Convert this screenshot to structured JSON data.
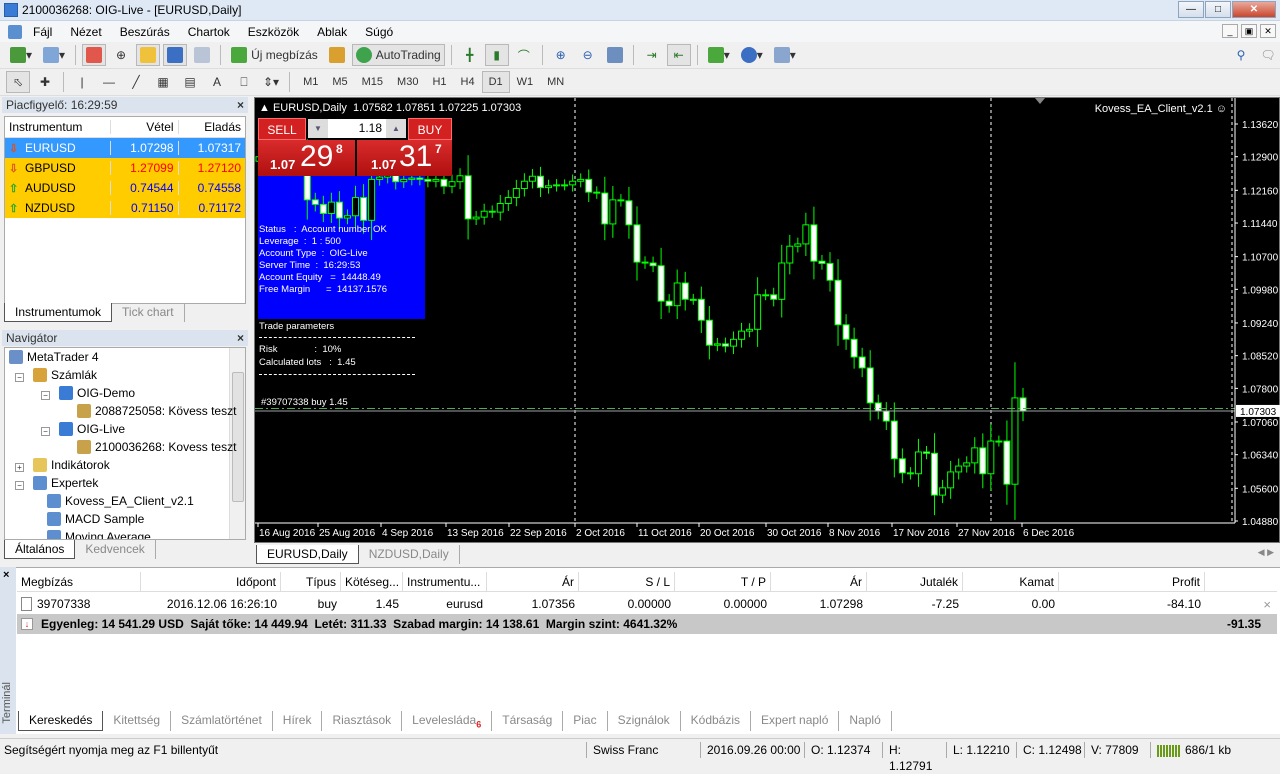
{
  "window": {
    "title": "2100036268: OIG-Live - [EURUSD,Daily]"
  },
  "menu": [
    "Fájl",
    "Nézet",
    "Beszúrás",
    "Chartok",
    "Eszközök",
    "Ablak",
    "Súgó"
  ],
  "toolbar": {
    "new_order": "Új megbízás",
    "autotrading": "AutoTrading",
    "timeframes": [
      "M1",
      "M5",
      "M15",
      "M30",
      "H1",
      "H4",
      "D1",
      "W1",
      "MN"
    ],
    "active_timeframe": "D1",
    "text_tool": "A"
  },
  "market_watch": {
    "title": "Piacfigyelő: 16:29:59",
    "columns": [
      "Instrumentum",
      "Vétel",
      "Eladás"
    ],
    "rows": [
      {
        "symbol": "EURUSD",
        "bid": "1.07298",
        "ask": "1.07317",
        "dir": "down",
        "selected": true,
        "color": "#ffffff"
      },
      {
        "symbol": "GBPUSD",
        "bid": "1.27099",
        "ask": "1.27120",
        "dir": "down",
        "selected": false,
        "color": "#ff0000"
      },
      {
        "symbol": "AUDUSD",
        "bid": "0.74544",
        "ask": "0.74558",
        "dir": "up",
        "selected": false,
        "color": "#0000ff"
      },
      {
        "symbol": "NZDUSD",
        "bid": "0.71150",
        "ask": "0.71172",
        "dir": "up",
        "selected": false,
        "color": "#0000ff"
      }
    ],
    "tabs": [
      "Instrumentumok",
      "Tick chart"
    ]
  },
  "navigator": {
    "title": "Navigátor",
    "items": [
      "MetaTrader 4",
      "Számlák",
      "OIG-Demo",
      "2088725058: Kövess teszt",
      "OIG-Live",
      "2100036268: Kovess teszt",
      "Indikátorok",
      "Expertek",
      "Kovess_EA_Client_v2.1",
      "MACD Sample",
      "Moving Average"
    ],
    "tabs": [
      "Általános",
      "Kedvencek"
    ]
  },
  "chart": {
    "header": "EURUSD,Daily  1.07582 1.07851 1.07225 1.07303",
    "ea_label": "Kovess_EA_Client_v2.1",
    "sell_label": "SELL",
    "buy_label": "BUY",
    "lots": "1.18",
    "sell_price": {
      "big": "1.07",
      "main": "29",
      "pip": "8"
    },
    "buy_price": {
      "big": "1.07",
      "main": "31",
      "pip": "7"
    },
    "info_lines": [
      "Status   :  Account number OK",
      "Leverage  :  1 : 500",
      "Account Type  :  OIG-Live",
      "Server Time  :  16:29:53",
      "Account Equity   =  14448.49",
      "Free Margin      =  14137.1576"
    ],
    "trade_params": [
      "Trade parameters",
      "Risk              :  10%",
      "Calculated lots   :  1.45"
    ],
    "order_label": "#39707338 buy 1.45",
    "current_price": "1.07303",
    "colors": {
      "background": "#000000",
      "candle": "#00ff00",
      "bear_body": "#ffffff",
      "info_panel": "#0000ff",
      "trade_button": "#d01818"
    },
    "tabs": [
      "EURUSD,Daily",
      "NZDUSD,Daily"
    ]
  },
  "chart_data": {
    "type": "candlestick",
    "symbol": "EURUSD",
    "timeframe": "Daily",
    "ylim": [
      1.0488,
      1.1362
    ],
    "y_ticks": [
      "1.13620",
      "1.12900",
      "1.12160",
      "1.11440",
      "1.10700",
      "1.09980",
      "1.09240",
      "1.08520",
      "1.07800",
      "1.07060",
      "1.06340",
      "1.05600",
      "1.04880"
    ],
    "x_ticks": [
      "16 Aug 2016",
      "25 Aug 2016",
      "4 Sep 2016",
      "13 Sep 2016",
      "22 Sep 2016",
      "2 Oct 2016",
      "11 Oct 2016",
      "20 Oct 2016",
      "30 Oct 2016",
      "8 Nov 2016",
      "17 Nov 2016",
      "27 Nov 2016",
      "6 Dec 2016"
    ],
    "first_open": 1.128,
    "closes": [
      1.129,
      1.133,
      1.1325,
      1.13,
      1.127,
      1.1285,
      1.1195,
      1.1185,
      1.1165,
      1.119,
      1.1155,
      1.116,
      1.12,
      1.115,
      1.124,
      1.1245,
      1.125,
      1.1235,
      1.124,
      1.1243,
      1.124,
      1.1236,
      1.124,
      1.1225,
      1.1235,
      1.1248,
      1.1153,
      1.1157,
      1.117,
      1.1168,
      1.1187,
      1.12,
      1.122,
      1.1236,
      1.1247,
      1.1222,
      1.1226,
      1.1228,
      1.1228,
      1.1236,
      1.124,
      1.1212,
      1.121,
      1.1142,
      1.1195,
      1.1193,
      1.114,
      1.1058,
      1.1056,
      1.105,
      1.0972,
      1.0962,
      1.1012,
      1.0976,
      1.0976,
      1.093,
      1.0875,
      1.0878,
      1.0873,
      1.0888,
      1.0906,
      1.091,
      1.0986,
      1.0986,
      1.0976,
      1.1056,
      1.1093,
      1.1098,
      1.114,
      1.106,
      1.1055,
      1.1018,
      1.092,
      1.0888,
      1.0849,
      1.0825,
      1.0748,
      1.073,
      1.0708,
      1.0625,
      1.0594,
      1.0592,
      1.064,
      1.0637,
      1.0545,
      1.0561,
      1.0596,
      1.0609,
      1.0616,
      1.0649,
      1.0592,
      1.0664,
      1.0664,
      1.0569,
      1.0759,
      1.073
    ],
    "bid_line": 1.07303,
    "order_line": 1.07356
  },
  "terminal": {
    "side_label": "Terminál",
    "columns": [
      "Megbízás",
      "Időpont",
      "Típus",
      "Kötéseg...",
      "Instrumentu...",
      "Ár",
      "S / L",
      "T / P",
      "Ár",
      "Jutalék",
      "Kamat",
      "Profit"
    ],
    "orders": [
      [
        "39707338",
        "2016.12.06 16:26:10",
        "buy",
        "1.45",
        "eurusd",
        "1.07356",
        "0.00000",
        "0.00000",
        "1.07298",
        "-7.25",
        "0.00",
        "-84.10"
      ]
    ],
    "summary": "Egyenleg: 14 541.29 USD  Saját tőke: 14 449.94  Letét: 311.33  Szabad margin: 14 138.61  Margin szint: 4641.32%",
    "total_profit": "-91.35",
    "tabs": [
      "Kereskedés",
      "Kitettség",
      "Számlatörténet",
      "Hírek",
      "Riasztások",
      "Levelesláda",
      "Társaság",
      "Piac",
      "Szignálok",
      "Kódbázis",
      "Expert napló",
      "Napló"
    ],
    "mail_badge": "6"
  },
  "status": {
    "help": "Segítségért nyomja meg az F1 billentyűt",
    "profile": "Swiss Franc",
    "datetime": "2016.09.26 00:00",
    "open": "O: 1.12374",
    "high": "H: 1.12791",
    "low": "L: 1.12210",
    "close": "C: 1.12498",
    "volume": "V: 77809",
    "traffic": "686/1 kb"
  }
}
